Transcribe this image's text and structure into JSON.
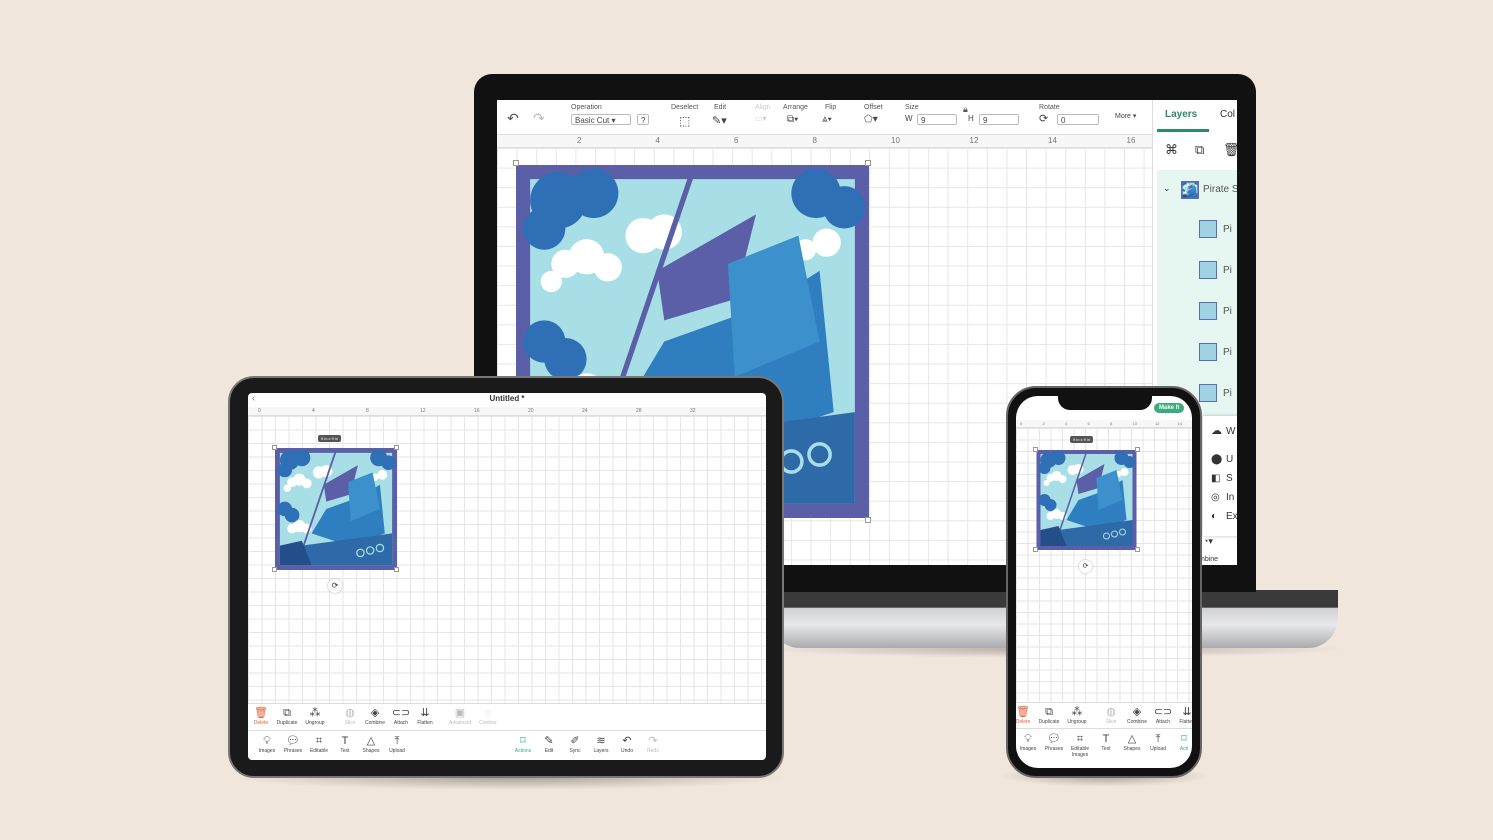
{
  "laptop": {
    "toolbar": {
      "undo_icon": "undo-icon",
      "redo_icon": "redo-icon",
      "operation_label": "Operation",
      "operation_value": "Basic Cut",
      "help": "?",
      "deselect": "Deselect",
      "edit": "Edit",
      "align": "Align",
      "arrange": "Arrange",
      "flip": "Flip",
      "offset": "Offset",
      "size": "Size",
      "w_label": "W",
      "w_value": "9",
      "h_label": "H",
      "h_value": "9",
      "rotate": "Rotate",
      "rotate_value": "0",
      "more": "More ▾"
    },
    "ruler": [
      "2",
      "4",
      "6",
      "8",
      "10",
      "12",
      "14",
      "16"
    ],
    "layers_panel": {
      "tabs": [
        "Layers",
        "Col"
      ],
      "group": "Pirate S",
      "children": [
        "Pi",
        "Pi",
        "Pi",
        "Pi",
        "Pi"
      ]
    },
    "menu": {
      "items": [
        "W",
        "U",
        "S",
        "In",
        "Ex"
      ],
      "combine": "mbine"
    }
  },
  "tablet": {
    "title": "Untitled *",
    "ruler": [
      "0",
      "4",
      "8",
      "12",
      "16",
      "20",
      "24",
      "28",
      "32"
    ],
    "size_badge": "9 in x 9 in",
    "edit_bar": [
      "Delete",
      "Duplicate",
      "Ungroup",
      "Slice",
      "Combine",
      "Attach",
      "Flatten",
      "Advanced",
      "Contour"
    ],
    "bottom_bar": [
      "Images",
      "Phrases",
      "Editable",
      "Text",
      "Shapes",
      "Upload",
      "Actions",
      "Edit",
      "Sync",
      "Layers",
      "Undo",
      "Redo"
    ]
  },
  "phone": {
    "title": "Untitled",
    "make_it": "Make It",
    "ruler": [
      "0",
      "2",
      "4",
      "6",
      "8",
      "10",
      "12",
      "14"
    ],
    "size_badge": "9 in x 9 in",
    "edit_bar": [
      "Delete",
      "Duplicate",
      "Ungroup",
      "Slice",
      "Combine",
      "Attach",
      "Flatten"
    ],
    "bottom_bar": [
      "Images",
      "Phrases",
      "Editable Images",
      "Text",
      "Shapes",
      "Upload",
      "Acti"
    ]
  },
  "colors": {
    "background": "#f0e6dc",
    "accent": "#3aaa7f",
    "frame": "#5a5fa8",
    "sky": "#a8dfe6",
    "sail": "#2f7fc0",
    "delete": "#e0603a"
  }
}
